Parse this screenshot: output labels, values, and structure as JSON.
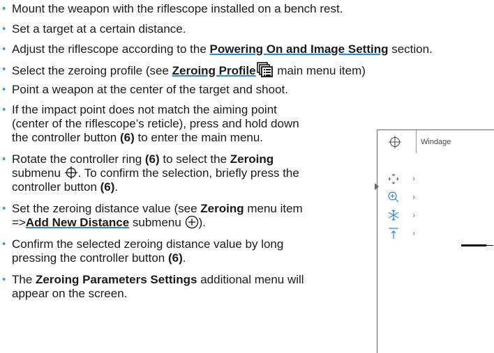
{
  "bullets": [
    {
      "text": "Mount the weapon with the riflescope installed on a bench rest."
    },
    {
      "text": "Set a target at a certain distance."
    },
    {
      "pre": "Adjust the riflescope according to the ",
      "link": "Powering On and Image Setting",
      "post": " section."
    },
    {
      "pre": "Select the zeroing profile (see ",
      "link": "Zeroing Profile",
      "post": " main menu item)"
    },
    {
      "text": "Point a weapon at the center of the target and shoot."
    },
    {
      "lines": [
        "If the impact point does not match the aiming point",
        "(center of the riflescope’s reticle), press and hold down"
      ],
      "l3_pre": "the controller button ",
      "l3_bold": "(6)",
      "l3_post": " to enter the main menu."
    },
    {
      "l1_pre": "Rotate the controller ring ",
      "l1_bold": "(6)",
      "l1_mid": " to select the ",
      "l1_bold2": "Zeroing",
      "l2_pre": "submenu ",
      "l2_post": ". To confirm the selection, briefly press the",
      "l3_pre": "controller button ",
      "l3_bold": "(6)",
      "l3_post": "."
    },
    {
      "l1_pre": "Set the zeroing distance value (see ",
      "l1_bold": "Zeroing",
      "l1_post": " menu item",
      "l2_pre": "=>",
      "l2_link": "Add New Distance",
      "l2_mid": " submenu ",
      "l2_post": ")."
    },
    {
      "l1": "Confirm the selected zeroing distance value by long",
      "l2_pre": "pressing the controller button ",
      "l2_bold": "(6)",
      "l2_post": "."
    },
    {
      "l1_pre": "The ",
      "l1_bold": "Zeroing Parameters Settings",
      "l1_post": " additional menu will",
      "l2": "appear on the screen."
    }
  ],
  "panel": {
    "title": "Windage",
    "icons": [
      "crosshair-icon",
      "move-arrows-icon",
      "zoom-plus-icon",
      "snowflake-icon",
      "arrow-up-bar-icon"
    ],
    "chevron": "›"
  },
  "colors": {
    "bullet": "#3aa0d8",
    "link_underline": "#2a8ad0",
    "text": "#1a1a1a"
  }
}
